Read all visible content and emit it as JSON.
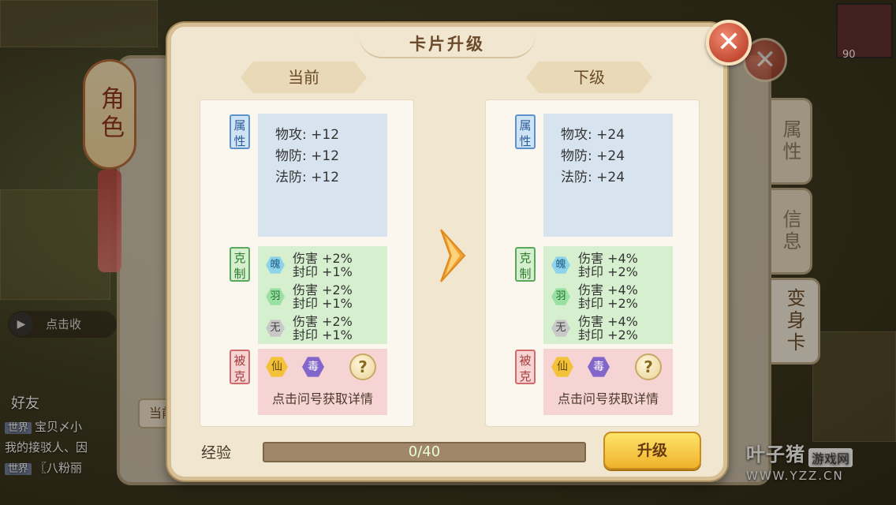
{
  "background": {
    "lantern_text": "角色",
    "side_tabs": [
      {
        "label": "属性"
      },
      {
        "label": "信息"
      },
      {
        "label": "变身卡"
      }
    ],
    "collect_label": "点击收",
    "friend_label": "好友",
    "partial_button": "当前",
    "chat": [
      {
        "tag": "世界",
        "text": "宝贝〆小"
      },
      {
        "tag": "",
        "text": "我的接驳人、因"
      },
      {
        "tag": "世界",
        "text": "〖八粉丽"
      }
    ],
    "hud_level": "90",
    "watermark": {
      "brand": "叶子猪",
      "box": "游戏网",
      "url": "WWW.YZZ.CN"
    }
  },
  "dialog": {
    "title": "卡片升级",
    "close_icon": "close-x",
    "current": {
      "header": "当前",
      "attr_label": "属性",
      "attrs": [
        "物攻: +12",
        "物防: +12",
        "法防: +12"
      ],
      "counter_label": "克制",
      "counters": [
        {
          "icon": "魄",
          "line1": "伤害 +2%",
          "line2": "封印 +1%"
        },
        {
          "icon": "羽",
          "line1": "伤害 +2%",
          "line2": "封印 +1%"
        },
        {
          "icon": "无",
          "line1": "伤害 +2%",
          "line2": "封印 +1%"
        }
      ],
      "weak_label": "被克",
      "weak_icons": [
        "仙",
        "毒"
      ],
      "help": "?",
      "hint": "点击问号获取详情"
    },
    "next": {
      "header": "下级",
      "attr_label": "属性",
      "attrs": [
        "物攻: +24",
        "物防: +24",
        "法防: +24"
      ],
      "counter_label": "克制",
      "counters": [
        {
          "icon": "魄",
          "line1": "伤害 +4%",
          "line2": "封印 +2%"
        },
        {
          "icon": "羽",
          "line1": "伤害 +4%",
          "line2": "封印 +2%"
        },
        {
          "icon": "无",
          "line1": "伤害 +4%",
          "line2": "封印 +2%"
        }
      ],
      "weak_label": "被克",
      "weak_icons": [
        "仙",
        "毒"
      ],
      "help": "?",
      "hint": "点击问号获取详情"
    },
    "exp_label": "经验",
    "exp_value": "0/40",
    "exp_progress": 0,
    "upgrade_label": "升级"
  }
}
